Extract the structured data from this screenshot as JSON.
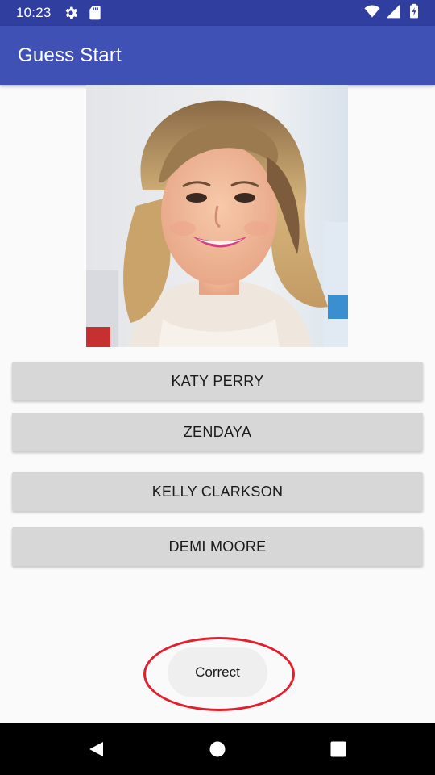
{
  "status_bar": {
    "time": "10:23",
    "left_icons": [
      "gear-icon",
      "sd-card-icon"
    ],
    "right_icons": [
      "wifi-icon",
      "signal-icon",
      "battery-charging-icon"
    ]
  },
  "app_bar": {
    "title": "Guess Start",
    "color": "#3f51b5",
    "status_color": "#303f9f"
  },
  "quiz": {
    "photo_subject": "celebrity-photo",
    "options": [
      {
        "label": "KATY PERRY"
      },
      {
        "label": "ZENDAYA"
      },
      {
        "label": "KELLY CLARKSON"
      },
      {
        "label": "DEMI MOORE"
      }
    ]
  },
  "toast": {
    "message": "Correct",
    "highlight_color": "#e41e2d"
  },
  "nav_bar": {
    "buttons": [
      "back-icon",
      "home-icon",
      "recents-icon"
    ]
  }
}
